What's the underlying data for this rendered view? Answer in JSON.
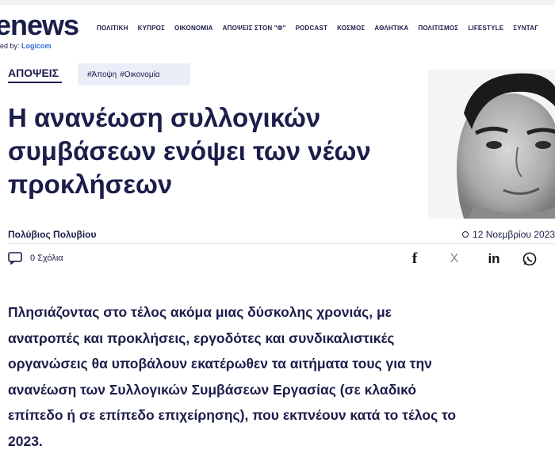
{
  "brand": {
    "logo": "enews",
    "powered_prefix": "ed by:",
    "powered_brand": "Logicom"
  },
  "nav": [
    "ΠΟΛΙΤΙΚΗ",
    "ΚΥΠΡΟΣ",
    "ΟΙΚΟΝΟΜΙΑ",
    "ΑΠΟΨΕΙΣ ΣΤΟΝ \"Φ\"",
    "PODCAST",
    "ΚΟΣΜΟΣ",
    "ΑΘΛΗΤΙΚΑ",
    "ΠΟΛΙΤΙΣΜΟΣ",
    "LIFESTYLE",
    "ΣΥΝΤΑΓ"
  ],
  "article": {
    "section": "ΑΠΟΨΕΙΣ",
    "tags": [
      "#Άποψη",
      "#Οικονομία"
    ],
    "headline_lines": [
      "Η ανανέωση συλλογικών",
      "συμβάσεων ενόψει των νέων",
      "προκλήσεων"
    ],
    "author": "Πολύβιος Πολυβίου",
    "date": "12 Νοεμβρίου 2023",
    "comments": "0 Σχόλια",
    "body_lines": [
      "Πλησιάζοντας στο τέλος ακόμα μιας δύσκολης χρονιάς, με",
      "ανατροπές και προκλήσεις, εργοδότες και συνδικαλιστικές",
      "οργανώσεις θα υποβάλουν εκατέρωθεν τα αιτήματα τους για την",
      "ανανέωση των Συλλογικών Συμβάσεων Εργασίας (σε κλαδικό",
      "επίπεδο ή σε επίπεδο επιχείρησης), που εκπνέουν κατά το τέλος το",
      "2023."
    ]
  },
  "share": {
    "facebook": "f",
    "x": "X",
    "linkedin": "in"
  },
  "colors": {
    "navy": "#1b1d4a",
    "tag_bg": "#e9eef8",
    "brand_blue": "#2f6fd6"
  },
  "icons": [
    "comment-icon",
    "facebook-icon",
    "x-icon",
    "linkedin-icon",
    "whatsapp-icon",
    "clock-icon"
  ]
}
